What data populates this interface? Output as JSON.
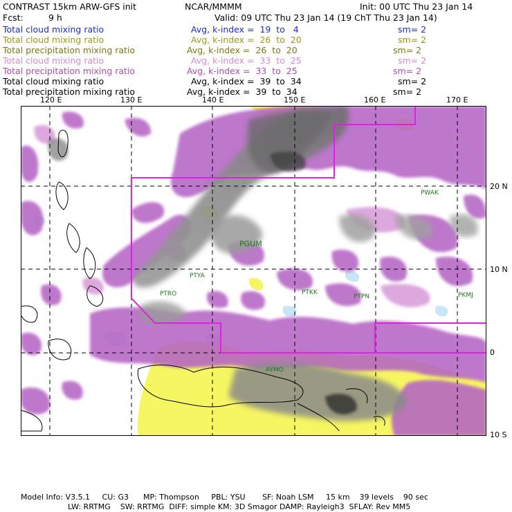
{
  "header": {
    "title": "CONTRAST 15km ARW-GFS init",
    "org": "NCAR/MMMM",
    "init": "Init: 00 UTC Thu 23 Jan 14",
    "fcst_label": "Fcst:",
    "fcst_value": "9 h",
    "valid": "Valid: 09 UTC Thu 23 Jan 14 (19 ChT Thu 23 Jan 14)"
  },
  "legend": [
    {
      "name": "Total cloud mixing ratio",
      "desc": "Avg, k-index =  19  to   4",
      "sm": "sm= 2",
      "color": "#1c2ad6"
    },
    {
      "name": "Total cloud mixing ratio",
      "desc": "Avg, k-index =  26  to  20",
      "sm": "sm= 2",
      "color": "#9a9a12"
    },
    {
      "name": "Total precipitation mixing ratio",
      "desc": "Avg, k-index =  26  to  20",
      "sm": "sm= 2",
      "color": "#7a7a10"
    },
    {
      "name": "Total cloud mixing ratio",
      "desc": "Avg, k-index =  33  to  25",
      "sm": "sm= 2",
      "color": "#d48ad4"
    },
    {
      "name": "Total precipitation mixing ratio",
      "desc": "Avg, k-index =  33  to  25",
      "sm": "sm= 2",
      "color": "#b24ab2"
    },
    {
      "name": "Total cloud mixing ratio",
      "desc": "Avg, k-index =  39  to  34",
      "sm": "sm= 2",
      "color": "#000000"
    },
    {
      "name": "Total precipitation mixing ratio",
      "desc": "Avg, k-index =  39  to  34",
      "sm": "sm= 2",
      "color": "#000000"
    }
  ],
  "axes": {
    "lon_labels": [
      "120 E",
      "130 E",
      "140 E",
      "150 E",
      "160 E",
      "170 E"
    ],
    "lat_labels": [
      "20 N",
      "10 N",
      "0",
      "10 S"
    ]
  },
  "stations": [
    "PGUM",
    "PTYA",
    "PTRO",
    "PTKK",
    "PTPN",
    "PKMJ",
    "PWAK",
    "AYMO"
  ],
  "footer": {
    "line1": "Model Info: V3.5.1     CU: G3      MP: Thompson     PBL: YSU       SF: Noah LSM     15 km    39 levels    90 sec",
    "line2": "LW: RRTMG    SW: RRTMG  DIFF: simple KM: 3D Smagor DAMP: Rayleigh3  SFLAY: Rev MM5"
  },
  "colors": {
    "cloud_purple": "#b565c4",
    "cloud_pink": "#d89ad8",
    "precip_yellow": "#f5f55a",
    "light_blue": "#c8e6f5",
    "deep_gray": "#8a8a8a",
    "domain_box": "#e020e0"
  }
}
